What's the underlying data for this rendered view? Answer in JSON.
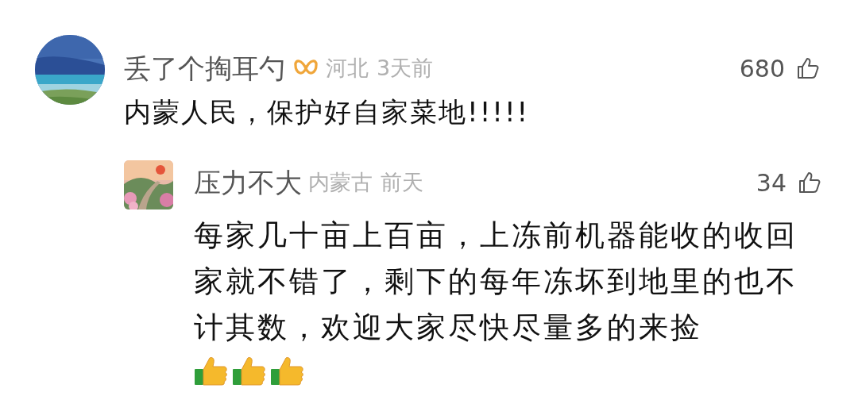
{
  "comments": [
    {
      "author": "丢了个掏耳勺",
      "badge": true,
      "location": "河北",
      "time": "3天前",
      "likes": "680",
      "text": "内蒙人民，保护好自家菜地!!!!!",
      "replies": [
        {
          "author": "压力不大",
          "badge": false,
          "location": "内蒙古",
          "time": "前天",
          "likes": "34",
          "text": "每家几十亩上百亩，上冻前机器能收的收回家就不错了，剩下的每年冻坏到地里的也不计其数，欢迎大家尽快尽量多的来捡",
          "emojis": [
            {
              "kind": "thumbs_up"
            },
            {
              "kind": "thumbs_up"
            },
            {
              "kind": "thumbs_up"
            }
          ]
        }
      ]
    }
  ]
}
